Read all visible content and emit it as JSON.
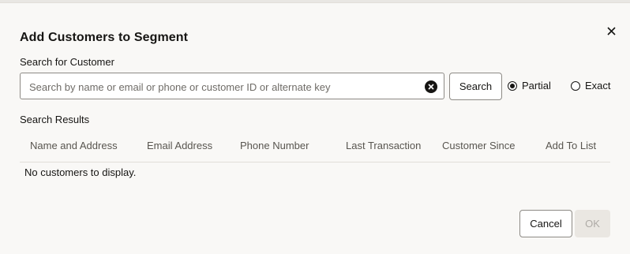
{
  "dialog": {
    "title": "Add Customers to Segment",
    "close_icon": "close-icon"
  },
  "search": {
    "label": "Search for Customer",
    "placeholder": "Search by name or email or phone or customer ID or alternate key",
    "value": "",
    "clear_icon": "clear-circle-icon",
    "button_label": "Search",
    "match_options": [
      {
        "label": "Partial",
        "selected": true
      },
      {
        "label": "Exact",
        "selected": false
      }
    ]
  },
  "results": {
    "label": "Search Results",
    "columns": [
      "Name and Address",
      "Email Address",
      "Phone Number",
      "Last Transaction",
      "Customer Since",
      "Add To List"
    ],
    "empty_message": "No customers to display."
  },
  "footer": {
    "cancel_label": "Cancel",
    "ok_label": "OK",
    "ok_disabled": true
  }
}
